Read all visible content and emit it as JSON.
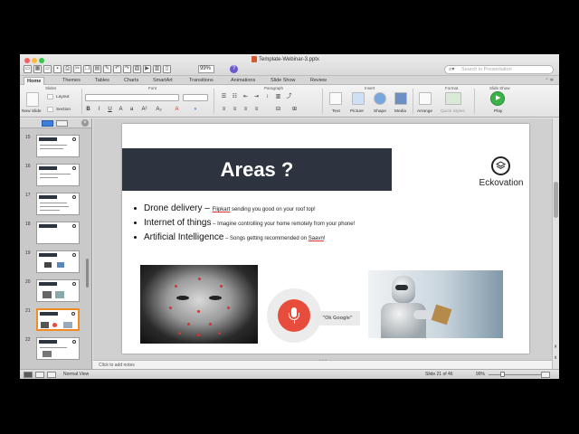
{
  "window": {
    "title": "Template-Webinar-3.pptx",
    "zoom": "99%",
    "search_placeholder": "Search in Presentation"
  },
  "ribbon": {
    "tabs": [
      "Home",
      "Themes",
      "Tables",
      "Charts",
      "SmartArt",
      "Transitions",
      "Animations",
      "Slide Show",
      "Review"
    ],
    "active_tab": "Home",
    "groups": {
      "slides": "Slides",
      "font": "Font",
      "paragraph": "Paragraph",
      "insert": "Insert",
      "format": "Format",
      "slide_show": "Slide Show"
    },
    "buttons": {
      "new_slide": "New Slide",
      "layout": "Layout",
      "section": "Section",
      "text": "Text",
      "picture": "Picture",
      "shape": "Shape",
      "media": "Media",
      "arrange": "Arrange",
      "quick_styles": "Quick Styles",
      "play": "Play"
    }
  },
  "slide_panel": {
    "numbers": [
      "15",
      "16",
      "17",
      "18",
      "19",
      "20",
      "21",
      "22"
    ],
    "selected": "21"
  },
  "slide": {
    "title": "Areas ?",
    "logo_text": "Eckovation",
    "bullets": [
      {
        "main": "Drone delivery",
        "sep": " – ",
        "link": "Flipkart",
        "rest": " sending you good on your roof top!"
      },
      {
        "main": "Internet of things",
        "sep": " – ",
        "link": "",
        "rest": "Imagine controlling your home remotely from your phone!"
      },
      {
        "main": "Artificial Intelligence",
        "sep": " – ",
        "link": "",
        "rest": "Songs getting recommended on ",
        "link2": "Saavn",
        "rest2": "!"
      }
    ],
    "ok_google": "\"Ok Google\""
  },
  "notes": {
    "placeholder": "Click to add notes"
  },
  "status": {
    "view": "Normal View",
    "slide_count": "Slide 21 of 46",
    "zoom": "99%"
  },
  "colors": {
    "title_band": "#2d3440",
    "mic_red": "#e74c3c",
    "selected_thumb": "#f08a24"
  }
}
